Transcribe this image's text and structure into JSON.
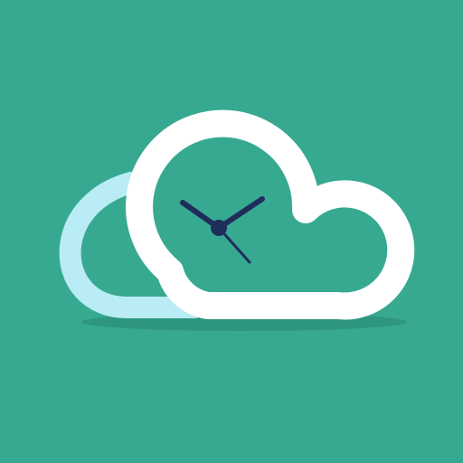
{
  "icon": {
    "name": "cloud-clock-icon",
    "colors": {
      "background": "#37a991",
      "cloud_outline": "#ffffff",
      "back_cloud_outline": "#b9ecf5",
      "cloud_fill": "#37a991",
      "clock_hands": "#1f2d5c",
      "shadow": "#2e9580"
    }
  }
}
